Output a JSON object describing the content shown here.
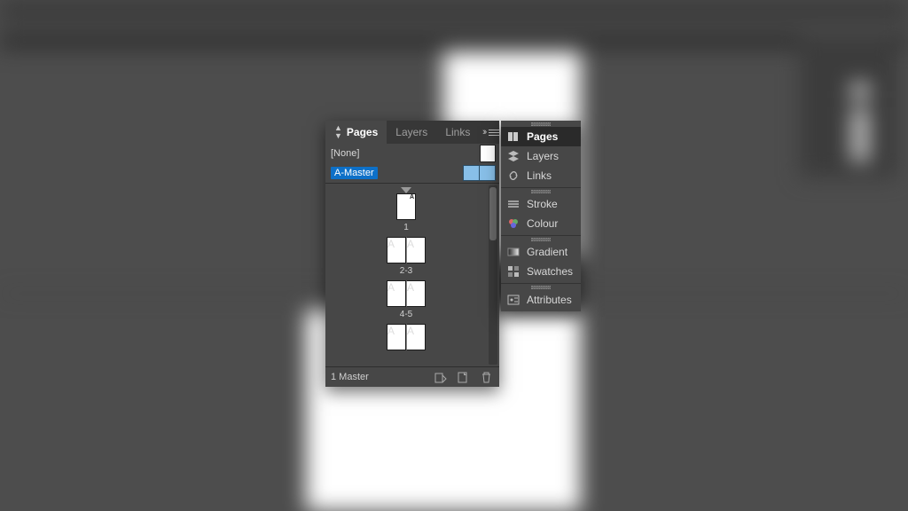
{
  "panel": {
    "tabs": [
      {
        "label": "Pages",
        "active": true
      },
      {
        "label": "Layers",
        "active": false
      },
      {
        "label": "Links",
        "active": false
      }
    ],
    "masters": {
      "none_label": "[None]",
      "a_master_label": "A-Master"
    },
    "page_labels": {
      "p1": "1",
      "p2_3": "2-3",
      "p4_5": "4-5",
      "marker": "A"
    },
    "footer": {
      "status": "1 Master"
    }
  },
  "dock": {
    "items": [
      {
        "label": "Pages",
        "icon": "pages-icon",
        "active": true
      },
      {
        "label": "Layers",
        "icon": "layers-icon",
        "active": false
      },
      {
        "label": "Links",
        "icon": "links-icon",
        "active": false
      },
      {
        "label": "Stroke",
        "icon": "stroke-icon",
        "active": false
      },
      {
        "label": "Colour",
        "icon": "colour-icon",
        "active": false
      },
      {
        "label": "Gradient",
        "icon": "gradient-icon",
        "active": false
      },
      {
        "label": "Swatches",
        "icon": "swatches-icon",
        "active": false
      },
      {
        "label": "Attributes",
        "icon": "attributes-icon",
        "active": false
      }
    ]
  }
}
